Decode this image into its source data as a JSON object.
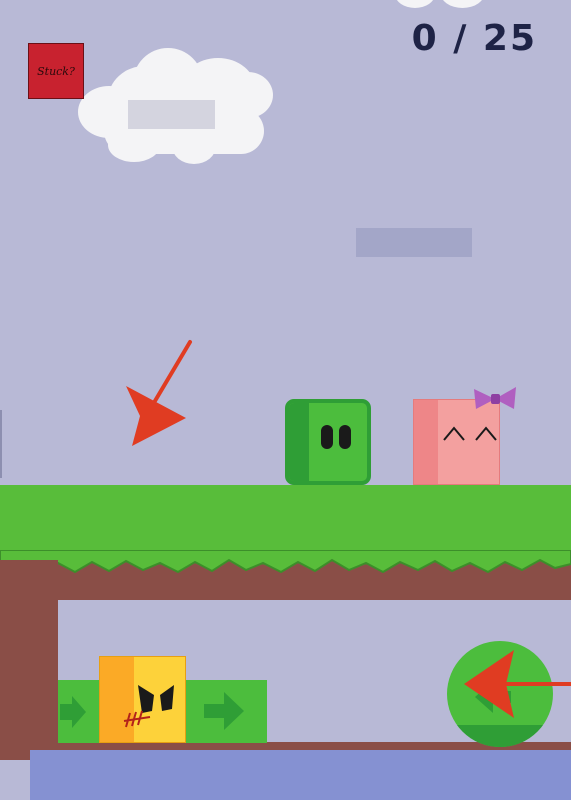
{
  "hud": {
    "stuck_label": "Stuck?",
    "counter_text": "0 / 25"
  },
  "colors": {
    "sky": "#b8b9d6",
    "grass": "#58bd3a",
    "dirt": "#8a4e47",
    "water": "#8591d2",
    "green_player": "#4cbd3d",
    "pink_character": "#f3a09f",
    "yellow_enemy": "#fdd23a",
    "hint_arrow": "#e03c22",
    "stuck_button": "#c8222f"
  },
  "icons": {
    "hint_arrow_top": "red-arrow-icon",
    "hint_arrow_right": "red-arrow-icon",
    "cave_arrow_right": "green-right-arrow-icon",
    "cave_arrow_left": "green-left-arrow-icon",
    "bow": "bow-icon"
  }
}
